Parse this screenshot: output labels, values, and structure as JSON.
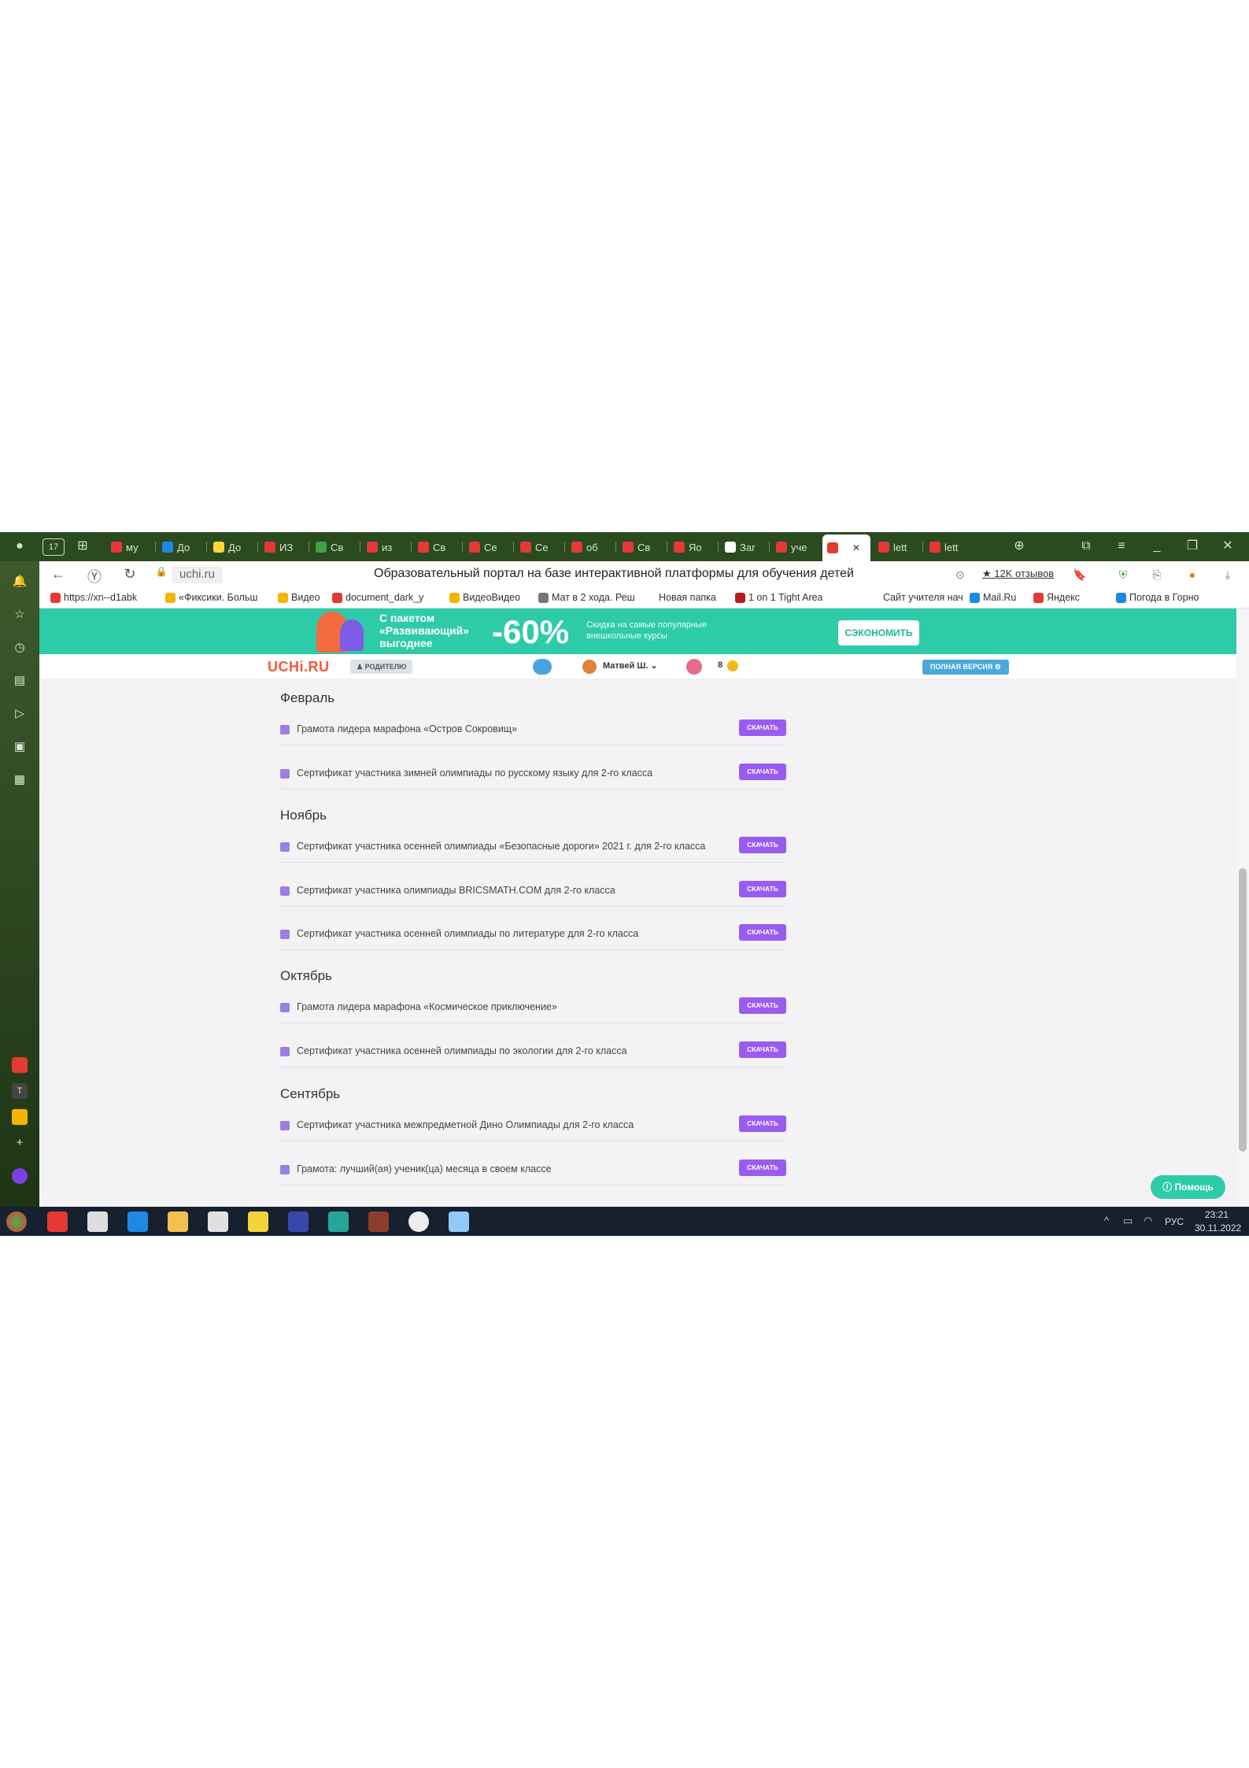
{
  "browser": {
    "tabs": [
      {
        "label": "му",
        "color": "#e53935"
      },
      {
        "label": "До",
        "color": "#1e88e5"
      },
      {
        "label": "До",
        "color": "#fdd835"
      },
      {
        "label": "ИЗ",
        "color": "#e53935"
      },
      {
        "label": "Св",
        "color": "#43a047"
      },
      {
        "label": "из",
        "color": "#e53935"
      },
      {
        "label": "Св",
        "color": "#e53935"
      },
      {
        "label": "Се",
        "color": "#e53935"
      },
      {
        "label": "Се",
        "color": "#e53935"
      },
      {
        "label": "об",
        "color": "#e53935"
      },
      {
        "label": "Св",
        "color": "#e53935"
      },
      {
        "label": "Яо",
        "color": "#e53935"
      },
      {
        "label": "Заг",
        "color": "#ffffff"
      },
      {
        "label": "уче",
        "color": "#e53935"
      },
      {
        "label": "",
        "color": "#e53935"
      },
      {
        "label": "lett",
        "color": "#e53935"
      },
      {
        "label": "lett",
        "color": "#e53935"
      }
    ],
    "tab_counter": "17",
    "url": "uchi.ru",
    "page_title": "Образовательный портал на базе интерактивной платформы для обучения детей",
    "reviews": "★ 12K отзывов",
    "bookmarks": [
      "https://xn--d1abk",
      "«Фиксики. Больш",
      "Видео",
      "document_dark_y",
      "ВидеоВидео",
      "Мат в 2 хода. Реш",
      "Новая папка",
      "1 on 1 Tight Area",
      "Сайт учителя нач",
      "Mail.Ru",
      "Яндекс",
      "Погода в Горно"
    ]
  },
  "banner": {
    "package": "С пакетом «Развивающий» выгоднее",
    "discount": "-60%",
    "description": "Скидка на самые популярные внешкольные курсы",
    "button": "СЭКОНОМИТЬ"
  },
  "header": {
    "logo": "UCHi.RU",
    "parent": "♟ РОДИТЕЛЮ",
    "user": "Матвей Ш. ⌄",
    "coins": "8",
    "full_version": "ПОЛНАЯ ВЕРСИЯ ⚙"
  },
  "download_label": "СКАЧАТЬ",
  "months": [
    {
      "name": "Февраль",
      "items": [
        "Грамота лидера марафона «Остров Сокровищ»",
        "Сертификат участника зимней олимпиады по русскому языку для 2-го класса"
      ]
    },
    {
      "name": "Ноябрь",
      "items": [
        "Сертификат участника осенней олимпиады «Безопасные дороги» 2021 г. для 2-го класса",
        "Сертификат участника олимпиады BRICSMATH.COM для 2-го класса",
        "Сертификат участника осенней олимпиады по литературе для 2-го класса"
      ]
    },
    {
      "name": "Октябрь",
      "items": [
        "Грамота лидера марафона «Космическое приключение»",
        "Сертификат участника осенней олимпиады по экологии для 2-го класса"
      ]
    },
    {
      "name": "Сентябрь",
      "items": [
        "Сертификат участника межпредметной Дино Олимпиады для 2-го класса",
        "Грамота: лучший(ая) ученик(ца) месяца в своем классе"
      ]
    }
  ],
  "help": "Помощь",
  "taskbar": {
    "language": "РУС",
    "time": "23:21",
    "date": "30.11.2022"
  }
}
